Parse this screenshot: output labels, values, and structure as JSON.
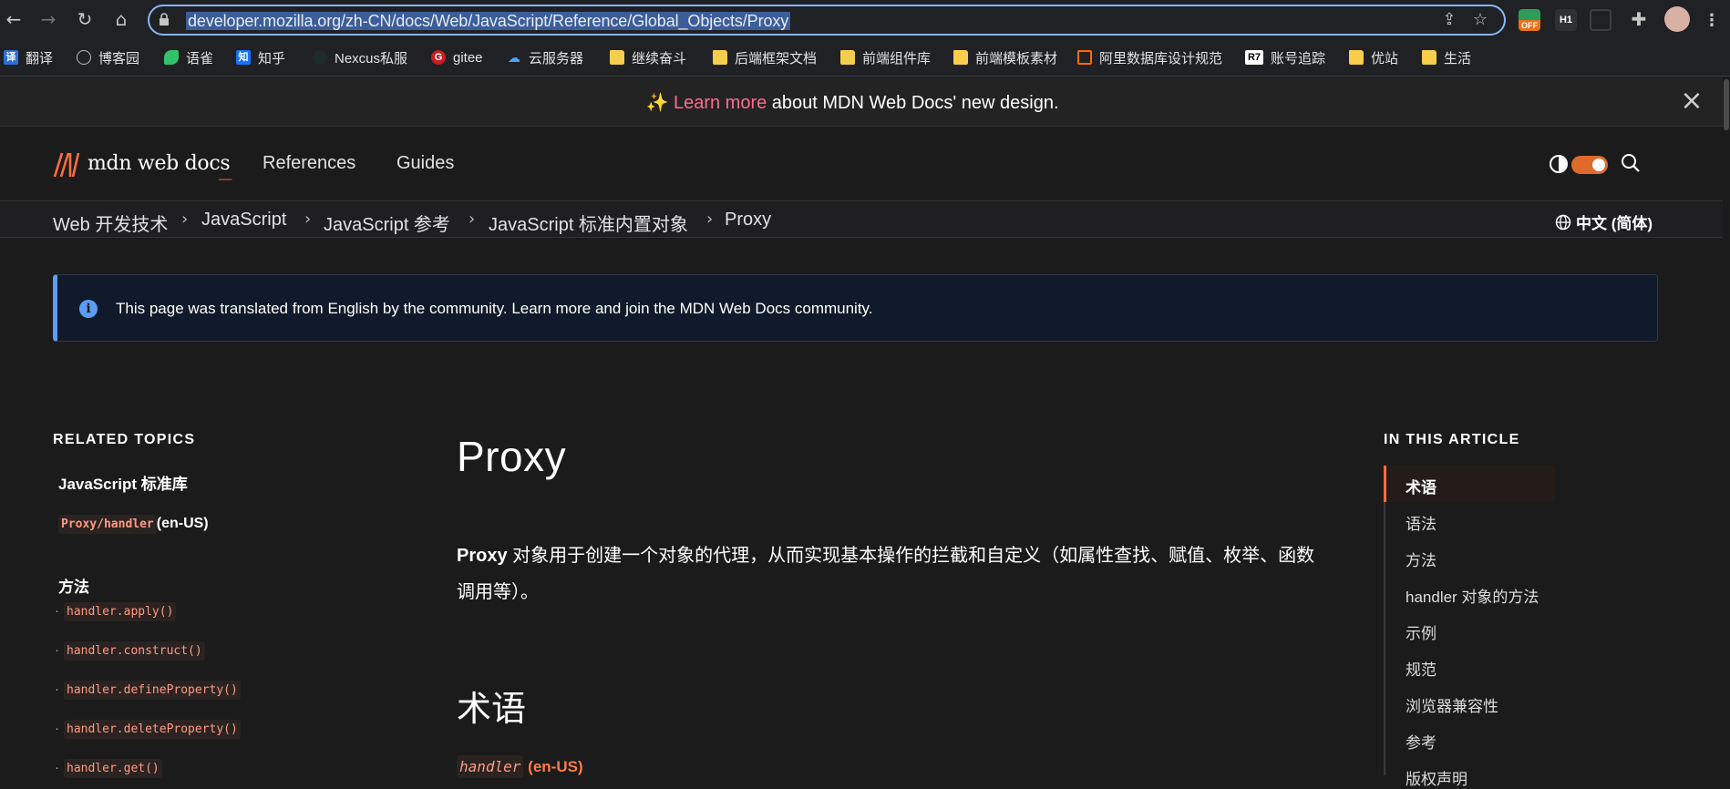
{
  "browser": {
    "url": "developer.mozilla.org/zh-CN/docs/Web/JavaScript/Reference/Global_Objects/Proxy",
    "extension_badge": "OFF",
    "h1_ext": "H1"
  },
  "bookmarks": [
    {
      "label": "翻译",
      "icon": "译"
    },
    {
      "label": "博客园",
      "icon": ""
    },
    {
      "label": "语雀",
      "icon": ""
    },
    {
      "label": "知乎",
      "icon": "知"
    },
    {
      "label": "Nexcus私服",
      "icon": ""
    },
    {
      "label": "gitee",
      "icon": "G"
    },
    {
      "label": "云服务器",
      "icon": ""
    },
    {
      "label": "继续奋斗",
      "icon": ""
    },
    {
      "label": "后端框架文档",
      "icon": ""
    },
    {
      "label": "前端组件库",
      "icon": ""
    },
    {
      "label": "前端模板素材",
      "icon": ""
    },
    {
      "label": "阿里数据库设计规范",
      "icon": ""
    },
    {
      "label": "账号追踪",
      "icon": "R7"
    },
    {
      "label": "优站",
      "icon": ""
    },
    {
      "label": "生活",
      "icon": ""
    }
  ],
  "banner": {
    "sparkle": "✨",
    "link": "Learn more",
    "rest": " about MDN Web Docs' new design."
  },
  "header": {
    "logo": "mdn web docs",
    "underscore": "_",
    "nav": [
      "References",
      "Guides"
    ]
  },
  "breadcrumbs": [
    "Web 开发技术",
    "JavaScript",
    "JavaScript 参考",
    "JavaScript 标准内置对象",
    "Proxy"
  ],
  "language": "中文 (简体)",
  "notice": "This page was translated from English by the community. Learn more and join the MDN Web Docs community.",
  "sidebar": {
    "heading": "RELATED TOPICS",
    "group": "JavaScript 标准库",
    "handler_code": "Proxy/handler",
    "handler_lang": "(en-US)",
    "methods_title": "方法",
    "methods": [
      "handler.apply()",
      "handler.construct()",
      "handler.defineProperty()",
      "handler.deleteProperty()",
      "handler.get()"
    ]
  },
  "main": {
    "title": "Proxy",
    "intro_bold": "Proxy",
    "intro_rest": " 对象用于创建一个对象的代理，从而实现基本操作的拦截和自定义（如属性查找、赋值、枚举、函数调用等）。",
    "section_title": "术语",
    "term_code": "handler",
    "term_lang": "(en-US)"
  },
  "toc": {
    "heading": "IN THIS ARTICLE",
    "items": [
      "术语",
      "语法",
      "方法",
      "handler 对象的方法",
      "示例",
      "规范",
      "浏览器兼容性",
      "参考",
      "版权声明"
    ]
  },
  "colors": {
    "accent": "#ff6d3f",
    "link_pink": "#ff6d91",
    "info_blue": "#5b9cf5"
  }
}
